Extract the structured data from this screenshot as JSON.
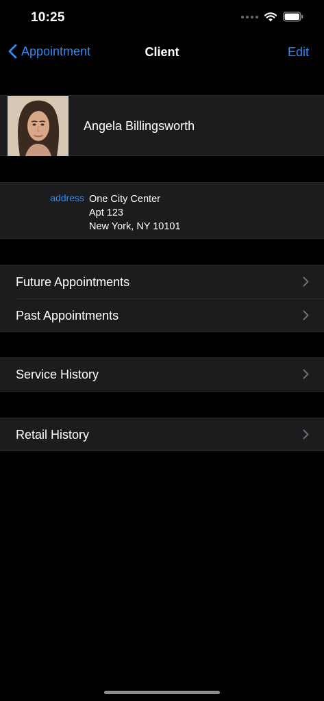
{
  "status_bar": {
    "time": "10:25"
  },
  "nav": {
    "back_label": "Appointment",
    "title": "Client",
    "edit_label": "Edit"
  },
  "client": {
    "name": "Angela Billingsworth"
  },
  "address": {
    "label": "address",
    "line1": "One City Center",
    "line2": "Apt 123",
    "line3": "New York, NY 10101"
  },
  "menu": {
    "future_appointments": "Future Appointments",
    "past_appointments": "Past Appointments",
    "service_history": "Service History",
    "retail_history": "Retail History"
  },
  "colors": {
    "accent": "#2f8bf5",
    "background": "#000000",
    "cell": "#1c1c1e",
    "chevron": "#6e6e73"
  },
  "icons": [
    "back-chevron-icon",
    "signal-icon",
    "wifi-icon",
    "battery-icon",
    "chevron-right-icon"
  ]
}
